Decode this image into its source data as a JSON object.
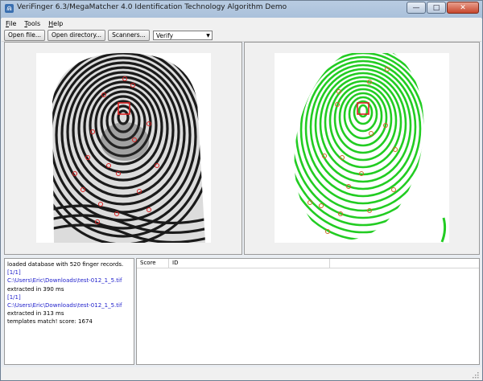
{
  "window": {
    "title": "VeriFinger 6.3/MegaMatcher 4.0 Identification Technology Algorithm Demo",
    "controls": {
      "minimize": "—",
      "maximize": "□",
      "close": "✕"
    }
  },
  "menu": [
    {
      "prefix": "F",
      "rest": "ile"
    },
    {
      "prefix": "T",
      "rest": "ools"
    },
    {
      "prefix": "H",
      "rest": "elp"
    }
  ],
  "toolbar": {
    "open_file": "Open file...",
    "open_directory": "Open directory...",
    "scanners": "Scanners...",
    "mode_select": "Verify"
  },
  "log": [
    {
      "text": "loaded database with 520 finger records.",
      "link": false
    },
    {
      "text": "[1/1]",
      "link": true
    },
    {
      "text": "C:\\Users\\Eric\\Downloads\\test-012_1_5.tif",
      "link": true
    },
    {
      "text": "extracted in 390 ms",
      "link": false
    },
    {
      "text": "[1/1]",
      "link": true
    },
    {
      "text": "C:\\Users\\Eric\\Downloads\\test-012_1_5.tif",
      "link": true
    },
    {
      "text": "extracted in 313 ms",
      "link": false
    },
    {
      "text": "templates match! score: 1674",
      "link": false
    }
  ],
  "results": {
    "columns": [
      "Score",
      "ID"
    ]
  },
  "colors": {
    "ridge_gray": "#1a1a1a",
    "ridge_green": "#22cc22",
    "minutia": "#dd2222",
    "minutia_green": "#cc6622",
    "link": "#2222cc"
  }
}
